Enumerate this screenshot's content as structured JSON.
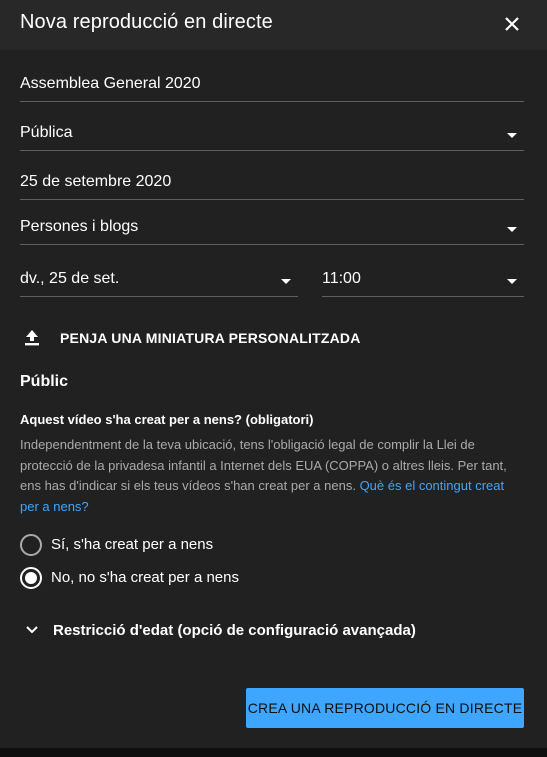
{
  "dialog": {
    "title": "Nova reproducció en directe",
    "close_icon": "close-icon"
  },
  "form": {
    "title_value": "Assemblea General 2020",
    "privacy_value": "Pública",
    "date_value": "25 de setembre 2020",
    "category_value": "Persones i blogs",
    "schedule_date_value": "dv., 25 de set.",
    "schedule_time_value": "11:00"
  },
  "thumbnail": {
    "icon": "upload-icon",
    "label": "PENJA UNA MINIATURA PERSONALITZADA"
  },
  "audience": {
    "section_title": "Públic",
    "question": "Aquest vídeo s'ha creat per a nens? (obligatori)",
    "description": "Independentment de la teva ubicació, tens l'obligació legal de complir la Llei de protecció de la privadesa infantil a Internet dels EUA (COPPA) o altres lleis. Per tant, ens has d'indicar si els teus vídeos s'han creat per a nens.",
    "link": "Què és el contingut creat per a nens?",
    "options": [
      {
        "label": "Sí, s'ha creat per a nens",
        "checked": false
      },
      {
        "label": "No, no s'ha creat per a nens",
        "checked": true
      }
    ]
  },
  "advanced": {
    "icon": "chevron-down-icon",
    "label": "Restricció d'edat (opció de configuració avançada)"
  },
  "actions": {
    "create_label": "CREA UNA REPRODUCCIÓ EN DIRECTE"
  },
  "colors": {
    "accent": "#3ea6ff",
    "background": "#212121",
    "header": "#282828"
  }
}
